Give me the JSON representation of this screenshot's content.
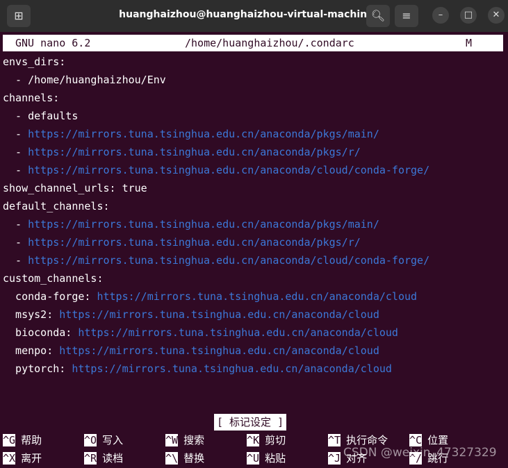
{
  "window": {
    "title": "huanghaizhou@huanghaizhou-virtual-machine: ~",
    "new_tab_icon": "terminal-tab-icon",
    "search_icon": "search-icon",
    "menu_icon": "hamburger-menu-icon",
    "minimize_glyph": "–",
    "maximize_glyph": "□",
    "close_glyph": "✕"
  },
  "nano": {
    "version": "GNU nano 6.2",
    "file": "/home/huanghaizhou/.condarc",
    "modified": "M"
  },
  "file_lines": [
    {
      "pre": "envs_dirs:",
      "url": ""
    },
    {
      "pre": "  - /home/huanghaizhou/Env",
      "url": ""
    },
    {
      "pre": "channels:",
      "url": ""
    },
    {
      "pre": "  - defaults",
      "url": ""
    },
    {
      "pre": "  - ",
      "url": "https://mirrors.tuna.tsinghua.edu.cn/anaconda/pkgs/main/"
    },
    {
      "pre": "  - ",
      "url": "https://mirrors.tuna.tsinghua.edu.cn/anaconda/pkgs/r/"
    },
    {
      "pre": "  - ",
      "url": "https://mirrors.tuna.tsinghua.edu.cn/anaconda/cloud/conda-forge/"
    },
    {
      "pre": "show_channel_urls: true",
      "url": ""
    },
    {
      "pre": "default_channels:",
      "url": ""
    },
    {
      "pre": "  - ",
      "url": "https://mirrors.tuna.tsinghua.edu.cn/anaconda/pkgs/main/"
    },
    {
      "pre": "  - ",
      "url": "https://mirrors.tuna.tsinghua.edu.cn/anaconda/pkgs/r/"
    },
    {
      "pre": "  - ",
      "url": "https://mirrors.tuna.tsinghua.edu.cn/anaconda/cloud/conda-forge/"
    },
    {
      "pre": "custom_channels:",
      "url": ""
    },
    {
      "pre": "  conda-forge: ",
      "url": "https://mirrors.tuna.tsinghua.edu.cn/anaconda/cloud"
    },
    {
      "pre": "  msys2: ",
      "url": "https://mirrors.tuna.tsinghua.edu.cn/anaconda/cloud"
    },
    {
      "pre": "  bioconda: ",
      "url": "https://mirrors.tuna.tsinghua.edu.cn/anaconda/cloud"
    },
    {
      "pre": "  menpo: ",
      "url": "https://mirrors.tuna.tsinghua.edu.cn/anaconda/cloud"
    },
    {
      "pre": "  pytorch: ",
      "url": "https://mirrors.tuna.tsinghua.edu.cn/anaconda/cloud"
    }
  ],
  "status_message": "[ 标记设定 ]",
  "shortcuts_row1": [
    {
      "key": "^G",
      "label": "帮助"
    },
    {
      "key": "^O",
      "label": "写入"
    },
    {
      "key": "^W",
      "label": "搜索"
    },
    {
      "key": "^K",
      "label": "剪切"
    },
    {
      "key": "^T",
      "label": "执行命令"
    },
    {
      "key": "^C",
      "label": "位置"
    }
  ],
  "shortcuts_row2": [
    {
      "key": "^X",
      "label": "离开"
    },
    {
      "key": "^R",
      "label": "读档"
    },
    {
      "key": "^\\",
      "label": "替换"
    },
    {
      "key": "^U",
      "label": "粘贴"
    },
    {
      "key": "^J",
      "label": "对齐"
    },
    {
      "key": "^/",
      "label": "跳行"
    }
  ],
  "watermark": "CSDN @weixin_47327329",
  "colors": {
    "terminal_bg": "#300a24",
    "titlebar_bg": "#2d2d2d",
    "url": "#3c78d8",
    "text": "#ffffff"
  }
}
